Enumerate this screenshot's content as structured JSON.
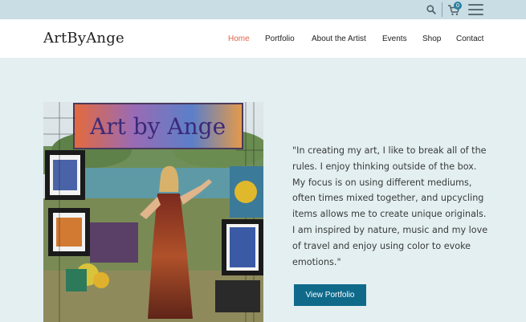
{
  "topbar": {
    "cart_count": "0",
    "icons": {
      "search": "search-icon",
      "cart": "cart-icon",
      "menu": "hamburger-menu-icon"
    }
  },
  "header": {
    "logo": "ArtByAnge",
    "nav": [
      {
        "label": "Home",
        "active": true
      },
      {
        "label": "Portfolio",
        "active": false
      },
      {
        "label": "About the Artist",
        "active": false
      },
      {
        "label": "Events",
        "active": false
      },
      {
        "label": "Shop",
        "active": false
      },
      {
        "label": "Contact",
        "active": false
      }
    ]
  },
  "hero": {
    "banner_text": "Art by Ange",
    "quote": "\"In creating my art, I like to break all of the rules. I enjoy thinking outside of the box. My focus is on using different mediums, often times mixed together, and upcycling items allows me to create unique originals. I am inspired by nature, music and my love of travel and enjoy using color to evoke emotions.\"",
    "button_label": "View Portfolio"
  },
  "colors": {
    "topbar_bg": "#c9dde5",
    "page_bg": "#e3eff1",
    "nav_active": "#e0644a",
    "button_bg": "#0f6a8a"
  }
}
